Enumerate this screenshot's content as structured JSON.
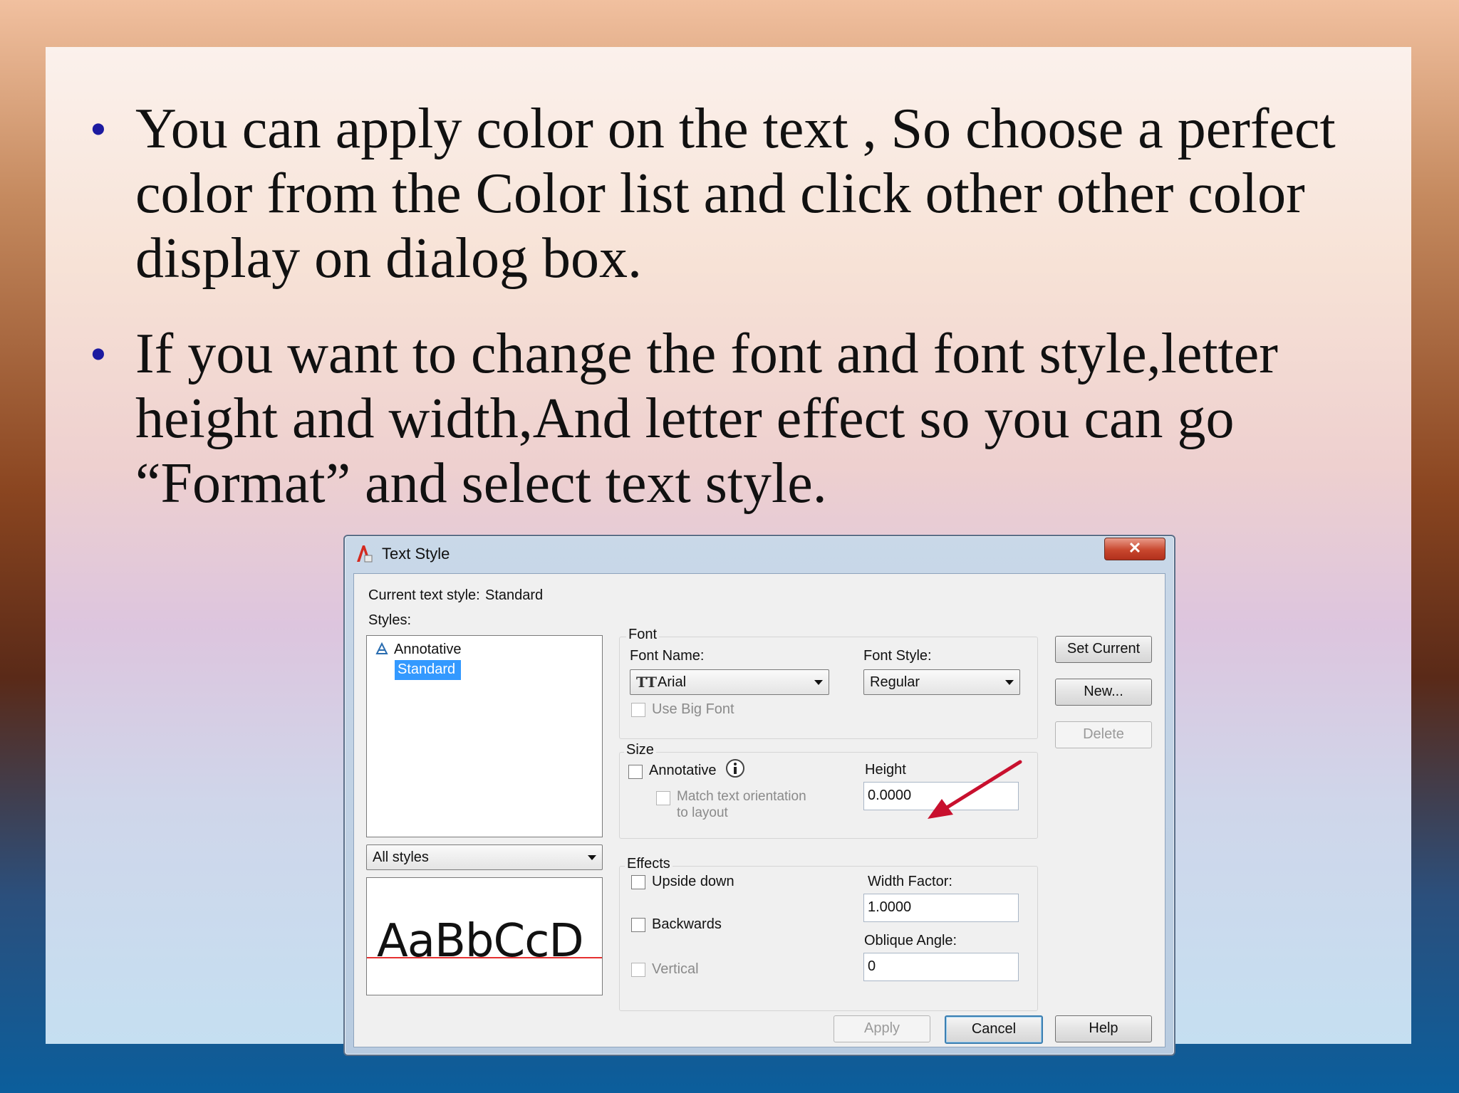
{
  "slide": {
    "bullets": [
      "You can apply color on the text , So choose a perfect color from the Color list and click other other color display on dialog box.",
      "If you want to change the font and font style,letter height and width,And letter effect so you can go “Format” and select text style."
    ],
    "bullet_glyph": "•"
  },
  "dialog": {
    "title": "Text Style",
    "close_glyph": "✕",
    "current_style_label": "Current text style:",
    "current_style_value": "Standard",
    "styles_label": "Styles:",
    "styles_list": [
      "Annotative",
      "Standard"
    ],
    "styles_filter": "All styles",
    "preview_text": "AaBbCcD",
    "font_group": {
      "title": "Font",
      "font_name_label": "Font Name:",
      "font_name_value": "Arial",
      "font_style_label": "Font Style:",
      "font_style_value": "Regular",
      "use_big_font": "Use Big Font"
    },
    "size_group": {
      "title": "Size",
      "annotative": "Annotative",
      "match_orientation_1": "Match text orientation",
      "match_orientation_2": "to layout",
      "height_label": "Height",
      "height_value": "0.0000"
    },
    "effects_group": {
      "title": "Effects",
      "upside_down": "Upside down",
      "backwards": "Backwards",
      "vertical": "Vertical",
      "width_factor_label": "Width Factor:",
      "width_factor_value": "1.0000",
      "oblique_angle_label": "Oblique Angle:",
      "oblique_angle_value": "0"
    },
    "buttons": {
      "set_current": "Set Current",
      "new": "New...",
      "delete": "Delete",
      "apply": "Apply",
      "cancel": "Cancel",
      "help": "Help"
    }
  },
  "colors": {
    "bullet": "#1c1aa0",
    "selection": "#3399ff",
    "annotation_arrow": "#c8102e"
  }
}
